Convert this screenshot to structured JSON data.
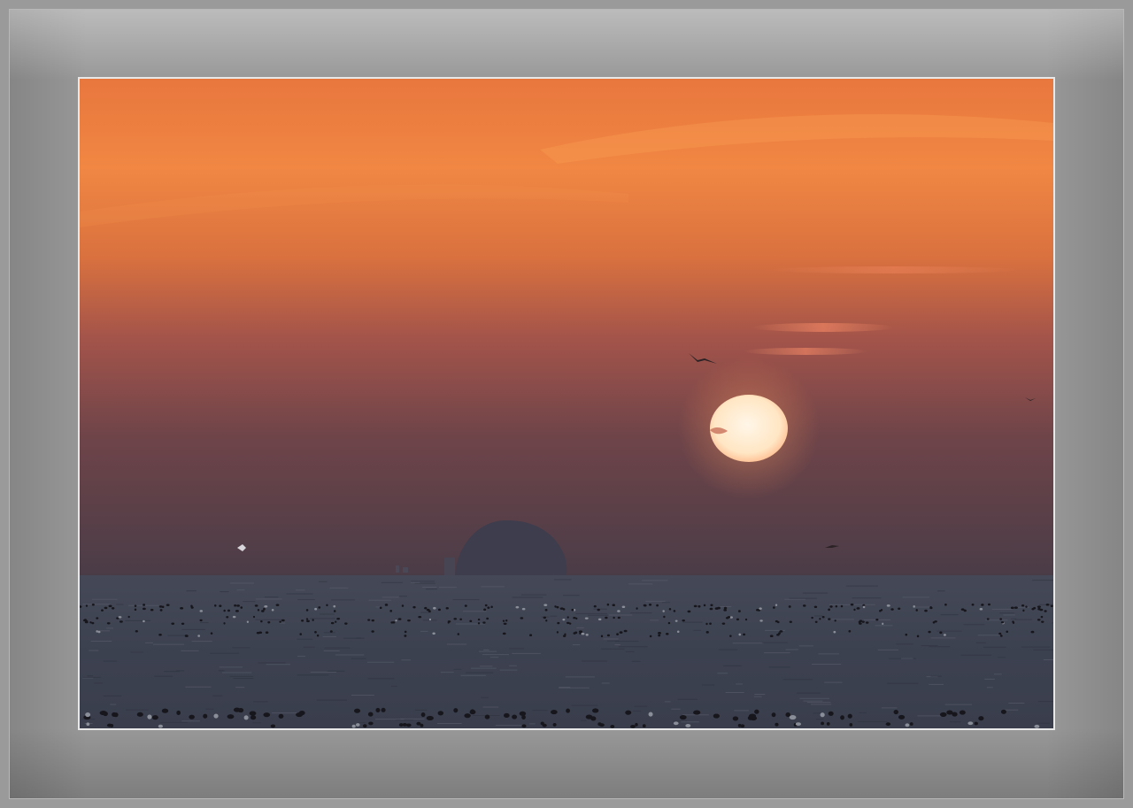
{
  "image": {
    "subject": "",
    "colors": {
      "sky_top": "#f08a45",
      "sky_mid": "#a1514a",
      "sky_low": "#4e3b45",
      "sea": "#3d4250",
      "sun": "#ffe9c8",
      "frame": "#989898",
      "photo_border": "#e8e8e8"
    },
    "elements": [
      "sun",
      "island",
      "birds",
      "buoys",
      "sea",
      "sky"
    ]
  }
}
